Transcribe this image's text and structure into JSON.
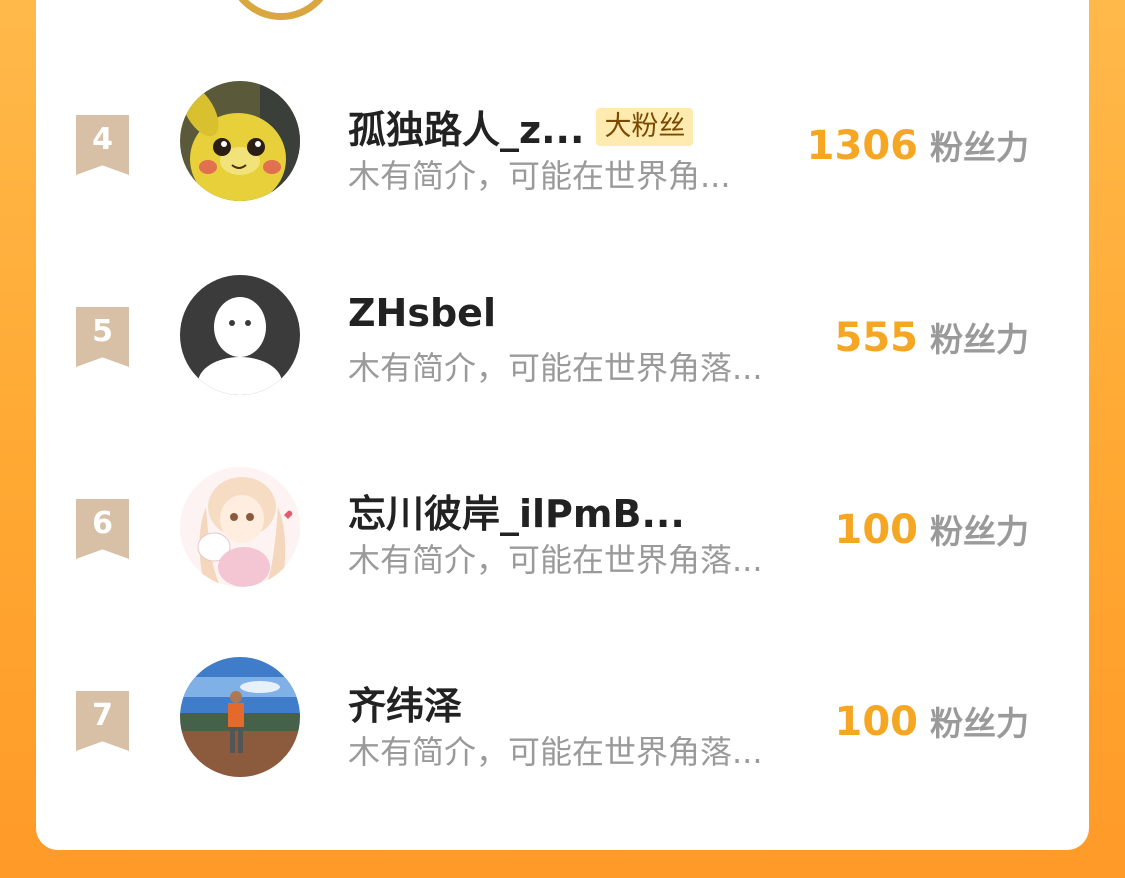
{
  "ranking": {
    "rows": [
      {
        "rank": "4",
        "name": "孤独路人_z...",
        "badge": "大粉丝",
        "bio": "木有简介，可能在世界角...",
        "score": "1306",
        "unit": "粉丝力",
        "avatar": "pikachu-avatar"
      },
      {
        "rank": "5",
        "name": "ZHsbel",
        "badge": "",
        "bio": "木有简介，可能在世界角落...",
        "score": "555",
        "unit": "粉丝力",
        "avatar": "default-user-avatar"
      },
      {
        "rank": "6",
        "name": "忘川彼岸_ilPmB...",
        "badge": "",
        "bio": "木有简介，可能在世界角落...",
        "score": "100",
        "unit": "粉丝力",
        "avatar": "anime-girl-avatar"
      },
      {
        "rank": "7",
        "name": "齐纬泽",
        "badge": "",
        "bio": "木有简介，可能在世界角落...",
        "score": "100",
        "unit": "粉丝力",
        "avatar": "hiker-landscape-avatar"
      }
    ]
  },
  "colors": {
    "background": "#FFA832",
    "score": "#F5A623",
    "rank_flag": "#D7C0A6",
    "badge_bg": "#FFEBB0"
  }
}
